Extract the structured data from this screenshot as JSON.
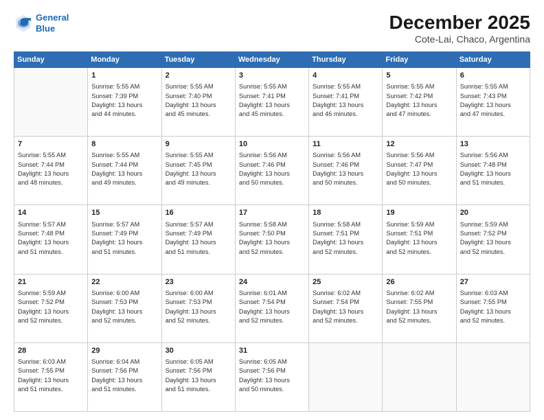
{
  "logo": {
    "line1": "General",
    "line2": "Blue"
  },
  "title": "December 2025",
  "subtitle": "Cote-Lai, Chaco, Argentina",
  "weekdays": [
    "Sunday",
    "Monday",
    "Tuesday",
    "Wednesday",
    "Thursday",
    "Friday",
    "Saturday"
  ],
  "weeks": [
    [
      {
        "day": "",
        "info": ""
      },
      {
        "day": "1",
        "info": "Sunrise: 5:55 AM\nSunset: 7:39 PM\nDaylight: 13 hours\nand 44 minutes."
      },
      {
        "day": "2",
        "info": "Sunrise: 5:55 AM\nSunset: 7:40 PM\nDaylight: 13 hours\nand 45 minutes."
      },
      {
        "day": "3",
        "info": "Sunrise: 5:55 AM\nSunset: 7:41 PM\nDaylight: 13 hours\nand 45 minutes."
      },
      {
        "day": "4",
        "info": "Sunrise: 5:55 AM\nSunset: 7:41 PM\nDaylight: 13 hours\nand 46 minutes."
      },
      {
        "day": "5",
        "info": "Sunrise: 5:55 AM\nSunset: 7:42 PM\nDaylight: 13 hours\nand 47 minutes."
      },
      {
        "day": "6",
        "info": "Sunrise: 5:55 AM\nSunset: 7:43 PM\nDaylight: 13 hours\nand 47 minutes."
      }
    ],
    [
      {
        "day": "7",
        "info": "Sunrise: 5:55 AM\nSunset: 7:44 PM\nDaylight: 13 hours\nand 48 minutes."
      },
      {
        "day": "8",
        "info": "Sunrise: 5:55 AM\nSunset: 7:44 PM\nDaylight: 13 hours\nand 49 minutes."
      },
      {
        "day": "9",
        "info": "Sunrise: 5:55 AM\nSunset: 7:45 PM\nDaylight: 13 hours\nand 49 minutes."
      },
      {
        "day": "10",
        "info": "Sunrise: 5:56 AM\nSunset: 7:46 PM\nDaylight: 13 hours\nand 50 minutes."
      },
      {
        "day": "11",
        "info": "Sunrise: 5:56 AM\nSunset: 7:46 PM\nDaylight: 13 hours\nand 50 minutes."
      },
      {
        "day": "12",
        "info": "Sunrise: 5:56 AM\nSunset: 7:47 PM\nDaylight: 13 hours\nand 50 minutes."
      },
      {
        "day": "13",
        "info": "Sunrise: 5:56 AM\nSunset: 7:48 PM\nDaylight: 13 hours\nand 51 minutes."
      }
    ],
    [
      {
        "day": "14",
        "info": "Sunrise: 5:57 AM\nSunset: 7:48 PM\nDaylight: 13 hours\nand 51 minutes."
      },
      {
        "day": "15",
        "info": "Sunrise: 5:57 AM\nSunset: 7:49 PM\nDaylight: 13 hours\nand 51 minutes."
      },
      {
        "day": "16",
        "info": "Sunrise: 5:57 AM\nSunset: 7:49 PM\nDaylight: 13 hours\nand 51 minutes."
      },
      {
        "day": "17",
        "info": "Sunrise: 5:58 AM\nSunset: 7:50 PM\nDaylight: 13 hours\nand 52 minutes."
      },
      {
        "day": "18",
        "info": "Sunrise: 5:58 AM\nSunset: 7:51 PM\nDaylight: 13 hours\nand 52 minutes."
      },
      {
        "day": "19",
        "info": "Sunrise: 5:59 AM\nSunset: 7:51 PM\nDaylight: 13 hours\nand 52 minutes."
      },
      {
        "day": "20",
        "info": "Sunrise: 5:59 AM\nSunset: 7:52 PM\nDaylight: 13 hours\nand 52 minutes."
      }
    ],
    [
      {
        "day": "21",
        "info": "Sunrise: 5:59 AM\nSunset: 7:52 PM\nDaylight: 13 hours\nand 52 minutes."
      },
      {
        "day": "22",
        "info": "Sunrise: 6:00 AM\nSunset: 7:53 PM\nDaylight: 13 hours\nand 52 minutes."
      },
      {
        "day": "23",
        "info": "Sunrise: 6:00 AM\nSunset: 7:53 PM\nDaylight: 13 hours\nand 52 minutes."
      },
      {
        "day": "24",
        "info": "Sunrise: 6:01 AM\nSunset: 7:54 PM\nDaylight: 13 hours\nand 52 minutes."
      },
      {
        "day": "25",
        "info": "Sunrise: 6:02 AM\nSunset: 7:54 PM\nDaylight: 13 hours\nand 52 minutes."
      },
      {
        "day": "26",
        "info": "Sunrise: 6:02 AM\nSunset: 7:55 PM\nDaylight: 13 hours\nand 52 minutes."
      },
      {
        "day": "27",
        "info": "Sunrise: 6:03 AM\nSunset: 7:55 PM\nDaylight: 13 hours\nand 52 minutes."
      }
    ],
    [
      {
        "day": "28",
        "info": "Sunrise: 6:03 AM\nSunset: 7:55 PM\nDaylight: 13 hours\nand 51 minutes."
      },
      {
        "day": "29",
        "info": "Sunrise: 6:04 AM\nSunset: 7:56 PM\nDaylight: 13 hours\nand 51 minutes."
      },
      {
        "day": "30",
        "info": "Sunrise: 6:05 AM\nSunset: 7:56 PM\nDaylight: 13 hours\nand 51 minutes."
      },
      {
        "day": "31",
        "info": "Sunrise: 6:05 AM\nSunset: 7:56 PM\nDaylight: 13 hours\nand 50 minutes."
      },
      {
        "day": "",
        "info": ""
      },
      {
        "day": "",
        "info": ""
      },
      {
        "day": "",
        "info": ""
      }
    ]
  ]
}
